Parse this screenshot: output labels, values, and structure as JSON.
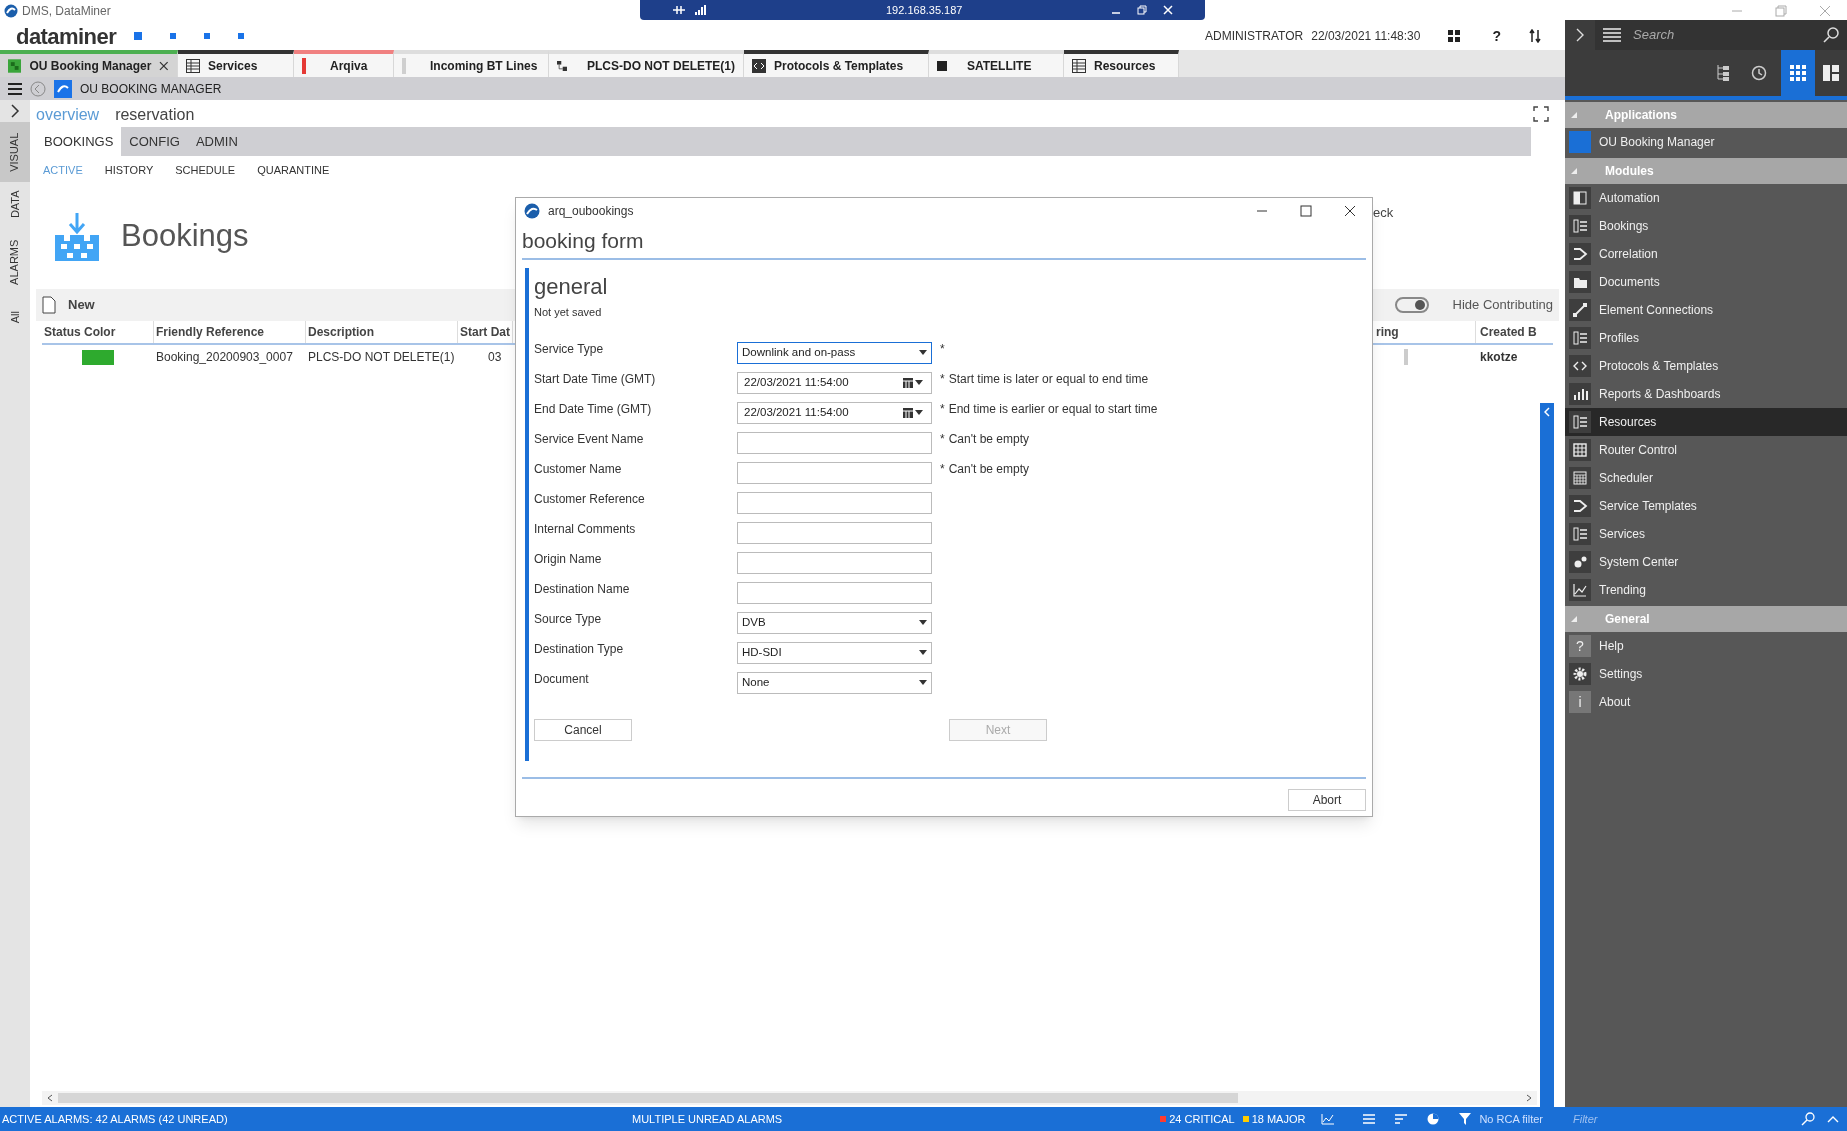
{
  "window": {
    "title": "DMS, DataMiner"
  },
  "remote_bar": {
    "address": "192.168.35.187"
  },
  "header": {
    "logo": "dataminer",
    "user": "ADMINISTRATOR",
    "datetime": "22/03/2021 11:48:30",
    "help": "?"
  },
  "tabs": [
    {
      "label": "OU Booking Manager",
      "kind": "app",
      "color": "#4caf50",
      "selected": true,
      "closable": true
    },
    {
      "label": "Services",
      "kind": "table",
      "color": "#333333",
      "selected": false,
      "closable": false
    },
    {
      "label": "Arqiva",
      "kind": "bar",
      "color": "#f08080",
      "selected": false,
      "closable": false
    },
    {
      "label": "Incoming BT Lines",
      "kind": "bar",
      "color": "#dddddd",
      "selected": false,
      "closable": false
    },
    {
      "label": "PLCS-DO NOT DELETE(1)",
      "kind": "diagram",
      "color": "#dddddd",
      "selected": false,
      "closable": false
    },
    {
      "label": "Protocols & Templates",
      "kind": "code",
      "color": "#333333",
      "selected": false,
      "closable": false
    },
    {
      "label": "SATELLITE",
      "kind": "square",
      "color": "#dddddd",
      "selected": false,
      "closable": false
    },
    {
      "label": "Resources",
      "kind": "table",
      "color": "#333333",
      "selected": false,
      "closable": false
    }
  ],
  "app_bar": {
    "title": "OU BOOKING MANAGER"
  },
  "side_strip": [
    {
      "label": "VISUAL",
      "selected": true
    },
    {
      "label": "DATA",
      "selected": false
    },
    {
      "label": "ALARMS",
      "selected": false
    },
    {
      "label": "All",
      "selected": false
    }
  ],
  "breadcrumb": [
    {
      "label": "overview",
      "selected": true
    },
    {
      "label": "reservation",
      "selected": false
    }
  ],
  "nav_tabs": [
    {
      "label": "BOOKINGS",
      "selected": true
    },
    {
      "label": "CONFIG",
      "selected": false
    },
    {
      "label": "ADMIN",
      "selected": false
    }
  ],
  "sub_tabs": [
    {
      "label": "ACTIVE",
      "selected": true
    },
    {
      "label": "HISTORY",
      "selected": false
    },
    {
      "label": "SCHEDULE",
      "selected": false
    },
    {
      "label": "QUARANTINE",
      "selected": false
    }
  ],
  "page_title": "Bookings",
  "partial_label": "eck",
  "toolbar": {
    "new": "New",
    "toggle_label": "Hide Contributing",
    "toggle_on": true
  },
  "table": {
    "columns": [
      "Status Color",
      "Friendly Reference",
      "Description",
      "Start Dat",
      "ring",
      "Created B"
    ],
    "rows": [
      {
        "color": "#2eaa2e",
        "cells": [
          null,
          "Booking_20200903_0007",
          "PLCS-DO NOT DELETE(1)",
          "03",
          null,
          "kkotze"
        ]
      }
    ]
  },
  "dialog": {
    "title": "arq_oubookings",
    "heading": "booking form",
    "section": "general",
    "status": "Not yet saved",
    "fields": [
      {
        "label": "Service Type",
        "kind": "select",
        "value": "Downlink and on-pass",
        "required_mark": "*",
        "focused": true
      },
      {
        "label": "Start Date Time (GMT)",
        "kind": "datetime",
        "value": "22/03/2021 11:54:00",
        "required_mark": "*",
        "error": "Start time is later or equal to end time",
        "focused": false
      },
      {
        "label": "End Date Time (GMT)",
        "kind": "datetime",
        "value": "22/03/2021 11:54:00",
        "required_mark": "*",
        "error": "End time is earlier or equal to start time",
        "focused": false
      },
      {
        "label": "Service Event Name",
        "kind": "text",
        "required_mark": "*",
        "error": "Can't be empty",
        "focused": false
      },
      {
        "label": "Customer Name",
        "kind": "text",
        "required_mark": "*",
        "error": "Can't be empty",
        "focused": false
      },
      {
        "label": "Customer Reference",
        "kind": "text",
        "focused": false
      },
      {
        "label": "Internal Comments",
        "kind": "text",
        "focused": false
      },
      {
        "label": "Origin Name",
        "kind": "text",
        "focused": false
      },
      {
        "label": "Destination Name",
        "kind": "text",
        "focused": false
      },
      {
        "label": "Source Type",
        "kind": "select",
        "value": "DVB",
        "focused": false
      },
      {
        "label": "Destination Type",
        "kind": "select",
        "value": "HD-SDI",
        "focused": false
      },
      {
        "label": "Document",
        "kind": "select",
        "value": "None",
        "focused": false
      }
    ],
    "cancel": "Cancel",
    "next": "Next",
    "next_disabled": true,
    "abort": "Abort"
  },
  "sidebar": {
    "search_placeholder": "Search",
    "sections": [
      {
        "title": "Applications",
        "items": [
          {
            "label": "OU Booking Manager",
            "kind": "app",
            "selected": false
          }
        ]
      },
      {
        "title": "Modules",
        "items": [
          {
            "label": "Automation",
            "kind": "panel",
            "selected": false
          },
          {
            "label": "Bookings",
            "kind": "list",
            "selected": false
          },
          {
            "label": "Correlation",
            "kind": "flow",
            "selected": false
          },
          {
            "label": "Documents",
            "kind": "folder",
            "selected": false
          },
          {
            "label": "Element Connections",
            "kind": "link",
            "selected": false
          },
          {
            "label": "Profiles",
            "kind": "list",
            "selected": false
          },
          {
            "label": "Protocols & Templates",
            "kind": "code",
            "selected": false
          },
          {
            "label": "Reports & Dashboards",
            "kind": "bars",
            "selected": false
          },
          {
            "label": "Resources",
            "kind": "list",
            "selected": true
          },
          {
            "label": "Router Control",
            "kind": "grid",
            "selected": false
          },
          {
            "label": "Scheduler",
            "kind": "calendar",
            "selected": false
          },
          {
            "label": "Service Templates",
            "kind": "flow",
            "selected": false
          },
          {
            "label": "Services",
            "kind": "list",
            "selected": false
          },
          {
            "label": "System Center",
            "kind": "gears",
            "selected": false
          },
          {
            "label": "Trending",
            "kind": "chart",
            "selected": false
          }
        ]
      },
      {
        "title": "General",
        "items": [
          {
            "label": "Help",
            "kind": "glyph",
            "glyph": "?",
            "selected": false
          },
          {
            "label": "Settings",
            "kind": "gear",
            "selected": false
          },
          {
            "label": "About",
            "kind": "glyph",
            "glyph": "i",
            "selected": false
          }
        ]
      }
    ]
  },
  "status_bar": {
    "alarms": "ACTIVE ALARMS: 42 ALARMS (42 UNREAD)",
    "message": "MULTIPLE UNREAD ALARMS",
    "counts": [
      {
        "label": "24 CRITICAL",
        "color": "#ff3b30"
      },
      {
        "label": "18 MAJOR",
        "color": "#ffcc00"
      }
    ],
    "rca_filter": "No RCA filter",
    "filter_placeholder": "Filter"
  }
}
